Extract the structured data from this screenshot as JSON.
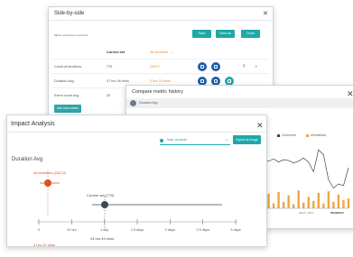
{
  "side_by_side": {
    "title": "Side-by-side",
    "metric_line": "Metric comparison overview",
    "buttons": [
      "Save",
      "Save as",
      "Close"
    ],
    "col_current": "Current set",
    "col_all": "All timelines",
    "rows": [
      {
        "label": "Count of timelines",
        "current": "779",
        "all": "23472"
      },
      {
        "label": "Duration Avg",
        "current": "47 hrs 46 mins",
        "all": "3 hrs 23 mins"
      },
      {
        "label": "Event count Avg",
        "current": "32",
        "all": "22"
      }
    ],
    "add_metric": "Add new metric"
  },
  "compare": {
    "title": "Compare metric history",
    "metric": "Duration Avg",
    "legend": [
      "Current set",
      "All timelines"
    ],
    "axis_labels": [
      "4/17",
      "04/27 / 2017",
      "05/09/2017"
    ],
    "colors": {
      "current": "#444444",
      "all": "#f0a640"
    },
    "chart_data": {
      "type": "line",
      "title": "",
      "xlabel": "",
      "ylabel": "",
      "series": [
        {
          "name": "Current set",
          "values": [
            60,
            58,
            61,
            57,
            60,
            59,
            56,
            58,
            62,
            57,
            45,
            72,
            66,
            35,
            25,
            30,
            28,
            50
          ]
        },
        {
          "name": "All timelines",
          "values": [
            10,
            18,
            6,
            20,
            8,
            16,
            5,
            22,
            7,
            14,
            9,
            19,
            6,
            21,
            8,
            17,
            10,
            12
          ]
        }
      ]
    }
  },
  "impact": {
    "title": "Impact Analysis",
    "select_value": "Map variable",
    "export_label": "Export as image",
    "subtitle": "Duration Avg",
    "all_label": "All timelines (23472)",
    "all_value": "3 hrs 22 mins",
    "current_label": "Current set (779)",
    "current_value": "24 hrs 49 mins",
    "ticks": [
      "0",
      "12 hrs",
      "1 day",
      "1.5 days",
      "2 days",
      "2.5 days",
      "3 days"
    ],
    "colors": {
      "accent": "#1fa8a8",
      "all": "#d9541e",
      "current": "#3a4a55"
    }
  }
}
